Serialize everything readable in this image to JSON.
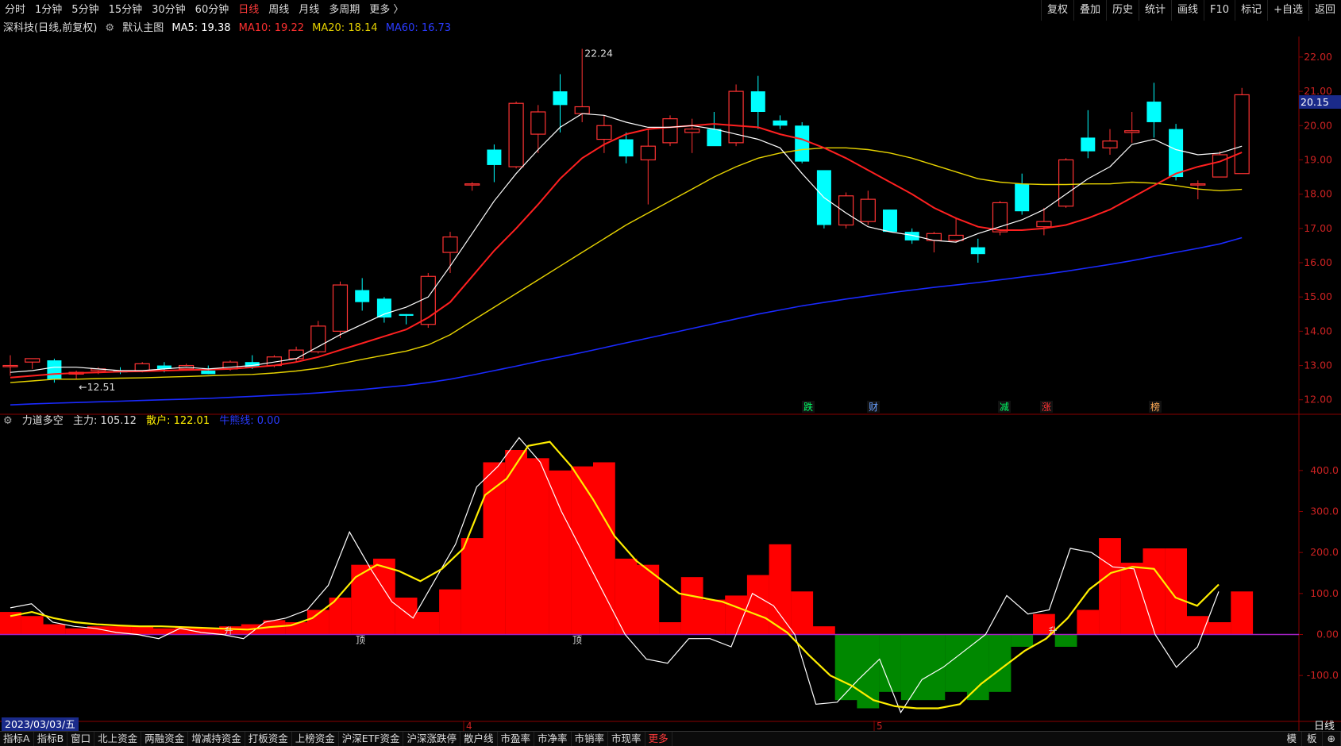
{
  "top_tabs": [
    "分时",
    "1分钟",
    "5分钟",
    "15分钟",
    "30分钟",
    "60分钟",
    "日线",
    "周线",
    "月线",
    "多周期",
    "更多 〉"
  ],
  "active_tab": "日线",
  "top_right": [
    "复权",
    "叠加",
    "历史",
    "统计",
    "画线",
    "F10",
    "标记",
    "+自选",
    "返回"
  ],
  "info": {
    "name": "深科技(日线,前复权)",
    "main": "默认主图",
    "ma5": "MA5: 19.38",
    "ma10": "MA10: 19.22",
    "ma20": "MA20: 18.14",
    "ma60": "MA60: 16.73"
  },
  "sub_info": {
    "name": "力道多空",
    "zhuli": "主力: 105.12",
    "sanhu": "散户: 122.01",
    "niuxiong": "牛熊线: 0.00"
  },
  "current_price": "20.15",
  "date_label": "2023/03/03/五",
  "period_label": "日线",
  "bottom_tabs": [
    "指标A",
    "指标B",
    "窗口",
    "北上资金",
    "两融资金",
    "增减持资金",
    "打板资金",
    "上榜资金",
    "沪深ETF资金",
    "沪深涨跌停",
    "散户线",
    "市盈率",
    "市净率",
    "市销率",
    "市现率",
    "更多"
  ],
  "bottom_right": [
    "模",
    "板",
    "⊕"
  ],
  "colors": {
    "up": "#ff3333",
    "down": "#00ffff",
    "ma5": "#ffffff",
    "ma10": "#ff2020",
    "ma20": "#e6d200",
    "ma60": "#1a2aff",
    "red_bar": "#ff0000",
    "green_bar": "#008800",
    "zhuli": "#ffffff",
    "sanhu": "#ffee00"
  },
  "chart_data": {
    "type": "candlestick",
    "price_axis": {
      "ylim": [
        11.6,
        22.6
      ],
      "ticks": [
        "22.00",
        "21.00",
        "20.00",
        "19.00",
        "18.00",
        "17.00",
        "16.00",
        "15.00",
        "14.00",
        "13.00",
        "12.00"
      ]
    },
    "sub_axis": {
      "ylim": [
        -210,
        510
      ],
      "ticks": [
        "400.0",
        "300.0",
        "200.0",
        "100.0",
        "0.00",
        "-100.0"
      ]
    },
    "month_marks": [
      "4",
      "5"
    ],
    "annotations": {
      "high": "22.24",
      "low": "←12.51",
      "top_label": "顶",
      "rise_label": "升"
    },
    "event_labels": [
      "跌",
      "财",
      "减",
      "涨",
      "榜"
    ],
    "candles": [
      {
        "o": 13.0,
        "h": 13.3,
        "l": 12.7,
        "c": 13.0
      },
      {
        "o": 13.1,
        "h": 13.2,
        "l": 12.9,
        "c": 13.2
      },
      {
        "o": 13.15,
        "h": 13.2,
        "l": 12.5,
        "c": 12.6
      },
      {
        "o": 12.75,
        "h": 12.85,
        "l": 12.6,
        "c": 12.8
      },
      {
        "o": 12.85,
        "h": 12.95,
        "l": 12.75,
        "c": 12.9
      },
      {
        "o": 12.85,
        "h": 12.95,
        "l": 12.75,
        "c": 12.8
      },
      {
        "o": 12.85,
        "h": 13.1,
        "l": 12.8,
        "c": 13.05
      },
      {
        "o": 13.0,
        "h": 13.1,
        "l": 12.8,
        "c": 12.9
      },
      {
        "o": 12.9,
        "h": 13.05,
        "l": 12.85,
        "c": 13.0
      },
      {
        "o": 12.85,
        "h": 13.0,
        "l": 12.75,
        "c": 12.75
      },
      {
        "o": 12.9,
        "h": 13.15,
        "l": 12.85,
        "c": 13.1
      },
      {
        "o": 13.1,
        "h": 13.3,
        "l": 12.9,
        "c": 12.95
      },
      {
        "o": 13.0,
        "h": 13.3,
        "l": 12.95,
        "c": 13.25
      },
      {
        "o": 13.2,
        "h": 13.55,
        "l": 13.1,
        "c": 13.45
      },
      {
        "o": 13.4,
        "h": 14.3,
        "l": 13.35,
        "c": 14.15
      },
      {
        "o": 14.0,
        "h": 15.45,
        "l": 13.8,
        "c": 15.35
      },
      {
        "o": 15.2,
        "h": 15.55,
        "l": 14.6,
        "c": 14.85
      },
      {
        "o": 14.95,
        "h": 15.0,
        "l": 14.25,
        "c": 14.4
      },
      {
        "o": 14.5,
        "h": 14.5,
        "l": 14.2,
        "c": 14.45
      },
      {
        "o": 14.2,
        "h": 15.7,
        "l": 14.1,
        "c": 15.6
      },
      {
        "o": 16.3,
        "h": 16.9,
        "l": 15.7,
        "c": 16.75
      },
      {
        "o": 18.3,
        "h": 18.35,
        "l": 18.1,
        "c": 18.3
      },
      {
        "o": 19.3,
        "h": 19.45,
        "l": 18.35,
        "c": 18.85
      },
      {
        "o": 18.8,
        "h": 20.7,
        "l": 18.75,
        "c": 20.65
      },
      {
        "o": 19.75,
        "h": 20.6,
        "l": 19.2,
        "c": 20.4
      },
      {
        "o": 21.0,
        "h": 21.5,
        "l": 19.8,
        "c": 20.6
      },
      {
        "o": 20.35,
        "h": 22.24,
        "l": 20.1,
        "c": 20.55
      },
      {
        "o": 19.6,
        "h": 20.3,
        "l": 19.2,
        "c": 20.0
      },
      {
        "o": 19.6,
        "h": 19.8,
        "l": 18.9,
        "c": 19.1
      },
      {
        "o": 19.0,
        "h": 19.9,
        "l": 17.7,
        "c": 19.4
      },
      {
        "o": 19.5,
        "h": 20.3,
        "l": 19.4,
        "c": 20.2
      },
      {
        "o": 19.8,
        "h": 20.2,
        "l": 19.2,
        "c": 19.9
      },
      {
        "o": 19.9,
        "h": 20.4,
        "l": 19.5,
        "c": 19.4
      },
      {
        "o": 19.5,
        "h": 21.2,
        "l": 19.4,
        "c": 21.0
      },
      {
        "o": 21.0,
        "h": 21.45,
        "l": 19.9,
        "c": 20.4
      },
      {
        "o": 20.15,
        "h": 20.3,
        "l": 19.9,
        "c": 20.0
      },
      {
        "o": 20.0,
        "h": 20.1,
        "l": 18.9,
        "c": 18.95
      },
      {
        "o": 18.7,
        "h": 18.55,
        "l": 17.0,
        "c": 17.1
      },
      {
        "o": 17.1,
        "h": 18.05,
        "l": 17.0,
        "c": 17.95
      },
      {
        "o": 17.2,
        "h": 18.1,
        "l": 17.1,
        "c": 17.85
      },
      {
        "o": 17.55,
        "h": 17.55,
        "l": 16.9,
        "c": 16.9
      },
      {
        "o": 16.9,
        "h": 17.0,
        "l": 16.55,
        "c": 16.65
      },
      {
        "o": 16.65,
        "h": 16.9,
        "l": 16.3,
        "c": 16.85
      },
      {
        "o": 16.65,
        "h": 17.3,
        "l": 16.6,
        "c": 16.8
      },
      {
        "o": 16.45,
        "h": 16.7,
        "l": 16.0,
        "c": 16.25
      },
      {
        "o": 16.9,
        "h": 17.8,
        "l": 16.8,
        "c": 17.75
      },
      {
        "o": 18.3,
        "h": 18.6,
        "l": 17.4,
        "c": 17.5
      },
      {
        "o": 17.05,
        "h": 17.6,
        "l": 16.8,
        "c": 17.2
      },
      {
        "o": 17.65,
        "h": 19.05,
        "l": 17.6,
        "c": 19.0
      },
      {
        "o": 19.65,
        "h": 20.45,
        "l": 19.05,
        "c": 19.25
      },
      {
        "o": 19.35,
        "h": 19.9,
        "l": 19.15,
        "c": 19.55
      },
      {
        "o": 19.8,
        "h": 20.4,
        "l": 19.5,
        "c": 19.85
      },
      {
        "o": 20.7,
        "h": 21.25,
        "l": 19.65,
        "c": 20.1
      },
      {
        "o": 19.9,
        "h": 20.05,
        "l": 18.4,
        "c": 18.5
      },
      {
        "o": 18.3,
        "h": 18.4,
        "l": 17.85,
        "c": 18.3
      },
      {
        "o": 18.5,
        "h": 19.25,
        "l": 18.5,
        "c": 19.15
      },
      {
        "o": 18.6,
        "h": 21.1,
        "l": 18.6,
        "c": 20.9
      }
    ],
    "ma5": [
      12.8,
      12.85,
      12.95,
      12.95,
      12.9,
      12.85,
      12.85,
      12.9,
      12.95,
      12.9,
      12.95,
      13.0,
      13.1,
      13.2,
      13.55,
      13.9,
      14.2,
      14.5,
      14.7,
      15.0,
      15.9,
      16.85,
      17.8,
      18.6,
      19.3,
      19.95,
      20.35,
      20.3,
      20.1,
      19.95,
      19.95,
      20.0,
      19.9,
      19.75,
      19.6,
      19.35,
      18.6,
      17.9,
      17.45,
      17.05,
      16.9,
      16.8,
      16.65,
      16.6,
      16.85,
      17.05,
      17.25,
      17.55,
      18.0,
      18.45,
      18.8,
      19.45,
      19.6,
      19.3,
      19.15,
      19.2,
      19.4
    ],
    "ma10": [
      12.65,
      12.7,
      12.75,
      12.78,
      12.8,
      12.82,
      12.83,
      12.85,
      12.87,
      12.88,
      12.9,
      12.95,
      13.0,
      13.1,
      13.25,
      13.45,
      13.65,
      13.85,
      14.05,
      14.4,
      14.85,
      15.6,
      16.35,
      17.0,
      17.7,
      18.45,
      19.05,
      19.45,
      19.75,
      19.9,
      19.95,
      20.0,
      20.05,
      20.0,
      19.95,
      19.75,
      19.6,
      19.35,
      19.05,
      18.7,
      18.35,
      18.0,
      17.6,
      17.3,
      17.05,
      16.95,
      16.95,
      17.0,
      17.1,
      17.3,
      17.55,
      17.9,
      18.25,
      18.6,
      18.8,
      18.95,
      19.22
    ],
    "ma20": [
      12.5,
      12.55,
      12.6,
      12.6,
      12.62,
      12.63,
      12.64,
      12.66,
      12.68,
      12.7,
      12.72,
      12.74,
      12.78,
      12.84,
      12.92,
      13.05,
      13.18,
      13.3,
      13.42,
      13.6,
      13.9,
      14.3,
      14.7,
      15.1,
      15.5,
      15.9,
      16.3,
      16.7,
      17.1,
      17.45,
      17.8,
      18.15,
      18.5,
      18.8,
      19.05,
      19.2,
      19.3,
      19.35,
      19.35,
      19.3,
      19.2,
      19.05,
      18.85,
      18.65,
      18.45,
      18.35,
      18.3,
      18.28,
      18.28,
      18.3,
      18.3,
      18.35,
      18.32,
      18.25,
      18.15,
      18.1,
      18.14
    ],
    "ma60": [
      11.85,
      11.88,
      11.9,
      11.92,
      11.94,
      11.96,
      11.98,
      12.0,
      12.02,
      12.04,
      12.07,
      12.1,
      12.13,
      12.16,
      12.2,
      12.25,
      12.3,
      12.36,
      12.42,
      12.5,
      12.6,
      12.72,
      12.85,
      12.98,
      13.12,
      13.25,
      13.38,
      13.52,
      13.66,
      13.8,
      13.94,
      14.08,
      14.22,
      14.36,
      14.5,
      14.62,
      14.74,
      14.84,
      14.94,
      15.03,
      15.12,
      15.2,
      15.28,
      15.35,
      15.42,
      15.5,
      15.58,
      15.66,
      15.75,
      15.85,
      15.95,
      16.06,
      16.18,
      16.3,
      16.42,
      16.55,
      16.73
    ],
    "bars": [
      55,
      45,
      25,
      15,
      20,
      20,
      20,
      15,
      18,
      15,
      20,
      25,
      35,
      30,
      60,
      90,
      170,
      185,
      90,
      55,
      110,
      235,
      420,
      450,
      430,
      400,
      410,
      420,
      185,
      170,
      30,
      140,
      85,
      95,
      145,
      220,
      105,
      20,
      -160,
      -180,
      -140,
      -160,
      -160,
      -140,
      -160,
      -140,
      -30,
      50,
      -30,
      60,
      235,
      175,
      210,
      210,
      45,
      30,
      105
    ],
    "zhuli": [
      65,
      75,
      30,
      20,
      15,
      5,
      0,
      -10,
      15,
      5,
      0,
      -10,
      30,
      40,
      60,
      120,
      250,
      160,
      80,
      40,
      130,
      220,
      360,
      410,
      480,
      420,
      300,
      200,
      100,
      0,
      -60,
      -70,
      -10,
      -10,
      -30,
      100,
      70,
      0,
      -170,
      -165,
      -110,
      -60,
      -190,
      -110,
      -80,
      -40,
      0,
      95,
      50,
      60,
      210,
      200,
      165,
      160,
      0,
      -80,
      -30,
      105
    ],
    "sanhu": [
      45,
      55,
      40,
      30,
      25,
      22,
      20,
      20,
      18,
      16,
      14,
      12,
      18,
      22,
      40,
      80,
      140,
      170,
      155,
      130,
      160,
      210,
      340,
      380,
      460,
      470,
      410,
      330,
      240,
      180,
      140,
      100,
      90,
      80,
      60,
      40,
      5,
      -50,
      -100,
      -125,
      -160,
      -175,
      -180,
      -180,
      -170,
      -120,
      -80,
      -40,
      -10,
      40,
      110,
      150,
      165,
      160,
      90,
      70,
      122
    ]
  }
}
